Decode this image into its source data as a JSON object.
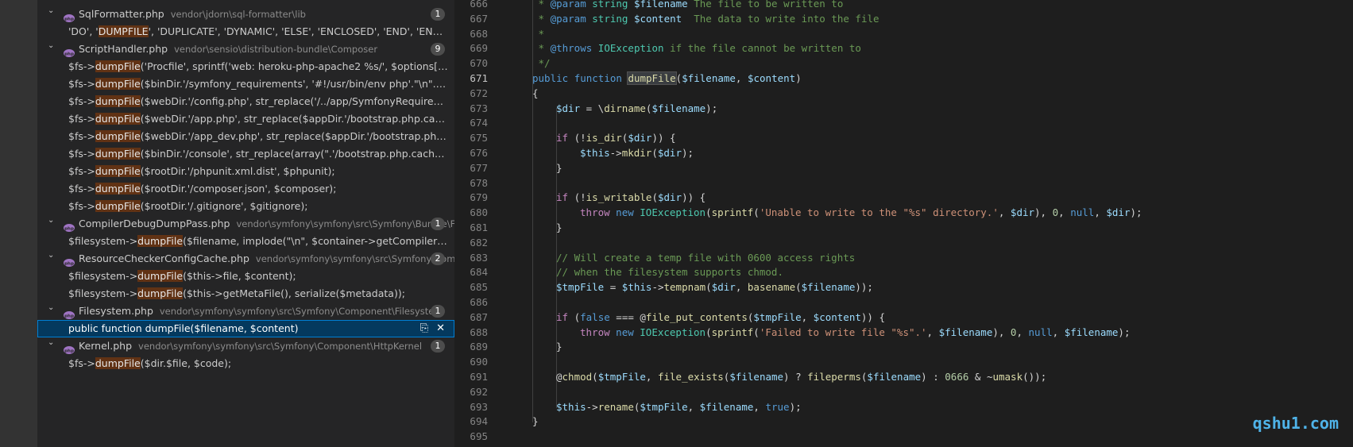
{
  "search_results": [
    {
      "type": "file",
      "name": "SqlFormatter.php",
      "path": "vendor\\jdorn\\sql-formatter\\lib",
      "count": "1"
    },
    {
      "type": "match",
      "pre": "'DO', '",
      "hl": "DUMPFILE",
      "post": "', 'DUPLICATE', 'DYNAMIC', 'ELSE', 'ENCLOSED', 'END', 'ENGINE', 'E..."
    },
    {
      "type": "file",
      "name": "ScriptHandler.php",
      "path": "vendor\\sensio\\distribution-bundle\\Composer",
      "count": "9"
    },
    {
      "type": "match",
      "pre": "$fs->",
      "hl": "dumpFile",
      "post": "('Procfile', sprintf('web: heroku-php-apache2 %s/', $options['symfon..."
    },
    {
      "type": "match",
      "pre": "$fs->",
      "hl": "dumpFile",
      "post": "($binDir.'/symfony_requirements', '#!/usr/bin/env php'.\"\\n\".str_repla..."
    },
    {
      "type": "match",
      "pre": "$fs->",
      "hl": "dumpFile",
      "post": "($webDir.'/config.php', str_replace('/../app/SymfonyRequirements.ph..."
    },
    {
      "type": "match",
      "pre": "$fs->",
      "hl": "dumpFile",
      "post": "($webDir.'/app.php', str_replace($appDir.'/bootstrap.php.cache', $var..."
    },
    {
      "type": "match",
      "pre": "$fs->",
      "hl": "dumpFile",
      "post": "($webDir.'/app_dev.php', str_replace($appDir.'/bootstrap.php.cache',..."
    },
    {
      "type": "match",
      "pre": "$fs->",
      "hl": "dumpFile",
      "post": "($binDir.'/console', str_replace(array(\".'/bootstrap.php.cache'\", \".'/Ap..."
    },
    {
      "type": "match",
      "pre": "$fs->",
      "hl": "dumpFile",
      "post": "($rootDir.'/phpunit.xml.dist', $phpunit);"
    },
    {
      "type": "match",
      "pre": "$fs->",
      "hl": "dumpFile",
      "post": "($rootDir.'/composer.json', $composer);"
    },
    {
      "type": "match",
      "pre": "$fs->",
      "hl": "dumpFile",
      "post": "($rootDir.'/.gitignore', $gitignore);"
    },
    {
      "type": "file",
      "name": "CompilerDebugDumpPass.php",
      "path": "vendor\\symfony\\symfony\\src\\Symfony\\Bundle\\F...",
      "count": "1"
    },
    {
      "type": "match",
      "pre": "$filesystem->",
      "hl": "dumpFile",
      "post": "($filename, implode(\"\\n\", $container->getCompiler()->getL..."
    },
    {
      "type": "file",
      "name": "ResourceCheckerConfigCache.php",
      "path": "vendor\\symfony\\symfony\\src\\Symfony\\Com...",
      "count": "2"
    },
    {
      "type": "match",
      "pre": "$filesystem->",
      "hl": "dumpFile",
      "post": "($this->file, $content);"
    },
    {
      "type": "match",
      "pre": "$filesystem->",
      "hl": "dumpFile",
      "post": "($this->getMetaFile(), serialize($metadata));"
    },
    {
      "type": "file",
      "name": "Filesystem.php",
      "path": "vendor\\symfony\\symfony\\src\\Symfony\\Component\\Filesystem",
      "count": "1"
    },
    {
      "type": "match",
      "pre": "public function ",
      "hl": "dumpFile",
      "post": "($filename, $content)",
      "selected": true
    },
    {
      "type": "file",
      "name": "Kernel.php",
      "path": "vendor\\symfony\\symfony\\src\\Symfony\\Component\\HttpKernel",
      "count": "1"
    },
    {
      "type": "match",
      "pre": "$fs->",
      "hl": "dumpFile",
      "post": "($dir.$file, $code);"
    }
  ],
  "selected_icons": {
    "replace": "⎘",
    "dismiss": "✕"
  },
  "editor": {
    "active_line": "671",
    "lines": [
      {
        "n": "666",
        "indent": 0,
        "toks": [
          {
            "c": "com",
            "t": " * "
          },
          {
            "c": "doc",
            "t": "@param"
          },
          {
            "c": "com",
            "t": " "
          },
          {
            "c": "cls",
            "t": "string"
          },
          {
            "c": "com",
            "t": " "
          },
          {
            "c": "var",
            "t": "$filename"
          },
          {
            "c": "com",
            "t": " The file to be written to"
          }
        ]
      },
      {
        "n": "667",
        "indent": 0,
        "toks": [
          {
            "c": "com",
            "t": " * "
          },
          {
            "c": "doc",
            "t": "@param"
          },
          {
            "c": "com",
            "t": " "
          },
          {
            "c": "cls",
            "t": "string"
          },
          {
            "c": "com",
            "t": " "
          },
          {
            "c": "var",
            "t": "$content"
          },
          {
            "c": "com",
            "t": "  The data to write into the file"
          }
        ]
      },
      {
        "n": "668",
        "indent": 0,
        "toks": [
          {
            "c": "com",
            "t": " *"
          }
        ]
      },
      {
        "n": "669",
        "indent": 0,
        "toks": [
          {
            "c": "com",
            "t": " * "
          },
          {
            "c": "doc",
            "t": "@throws"
          },
          {
            "c": "com",
            "t": " "
          },
          {
            "c": "cls",
            "t": "IOException"
          },
          {
            "c": "com",
            "t": " if the file cannot be written to"
          }
        ]
      },
      {
        "n": "670",
        "indent": 0,
        "toks": [
          {
            "c": "com",
            "t": " */"
          }
        ]
      },
      {
        "n": "671",
        "indent": 0,
        "toks": [
          {
            "c": "kw",
            "t": "public"
          },
          {
            "c": "plain",
            "t": " "
          },
          {
            "c": "kw",
            "t": "function"
          },
          {
            "c": "plain",
            "t": " "
          },
          {
            "c": "fnbox",
            "t": "dumpFile"
          },
          {
            "c": "plain",
            "t": "("
          },
          {
            "c": "var",
            "t": "$filename"
          },
          {
            "c": "plain",
            "t": ", "
          },
          {
            "c": "var",
            "t": "$content"
          },
          {
            "c": "plain",
            "t": ")"
          }
        ]
      },
      {
        "n": "672",
        "indent": 0,
        "toks": [
          {
            "c": "plain",
            "t": "{"
          }
        ]
      },
      {
        "n": "673",
        "indent": 1,
        "toks": [
          {
            "c": "var",
            "t": "$dir"
          },
          {
            "c": "plain",
            "t": " = \\"
          },
          {
            "c": "fn",
            "t": "dirname"
          },
          {
            "c": "plain",
            "t": "("
          },
          {
            "c": "var",
            "t": "$filename"
          },
          {
            "c": "plain",
            "t": ");"
          }
        ]
      },
      {
        "n": "674",
        "indent": 1,
        "toks": []
      },
      {
        "n": "675",
        "indent": 1,
        "toks": [
          {
            "c": "ctl",
            "t": "if"
          },
          {
            "c": "plain",
            "t": " (!"
          },
          {
            "c": "fn",
            "t": "is_dir"
          },
          {
            "c": "plain",
            "t": "("
          },
          {
            "c": "var",
            "t": "$dir"
          },
          {
            "c": "plain",
            "t": ")) {"
          }
        ]
      },
      {
        "n": "676",
        "indent": 2,
        "toks": [
          {
            "c": "var",
            "t": "$this"
          },
          {
            "c": "plain",
            "t": "->"
          },
          {
            "c": "fn",
            "t": "mkdir"
          },
          {
            "c": "plain",
            "t": "("
          },
          {
            "c": "var",
            "t": "$dir"
          },
          {
            "c": "plain",
            "t": ");"
          }
        ]
      },
      {
        "n": "677",
        "indent": 1,
        "toks": [
          {
            "c": "plain",
            "t": "}"
          }
        ]
      },
      {
        "n": "678",
        "indent": 1,
        "toks": []
      },
      {
        "n": "679",
        "indent": 1,
        "toks": [
          {
            "c": "ctl",
            "t": "if"
          },
          {
            "c": "plain",
            "t": " (!"
          },
          {
            "c": "fn",
            "t": "is_writable"
          },
          {
            "c": "plain",
            "t": "("
          },
          {
            "c": "var",
            "t": "$dir"
          },
          {
            "c": "plain",
            "t": ")) {"
          }
        ]
      },
      {
        "n": "680",
        "indent": 2,
        "toks": [
          {
            "c": "ctl",
            "t": "throw"
          },
          {
            "c": "plain",
            "t": " "
          },
          {
            "c": "kw",
            "t": "new"
          },
          {
            "c": "plain",
            "t": " "
          },
          {
            "c": "cls",
            "t": "IOException"
          },
          {
            "c": "plain",
            "t": "("
          },
          {
            "c": "fn",
            "t": "sprintf"
          },
          {
            "c": "plain",
            "t": "("
          },
          {
            "c": "str",
            "t": "'Unable to write to the \"%s\" directory.'"
          },
          {
            "c": "plain",
            "t": ", "
          },
          {
            "c": "var",
            "t": "$dir"
          },
          {
            "c": "plain",
            "t": "), "
          },
          {
            "c": "num",
            "t": "0"
          },
          {
            "c": "plain",
            "t": ", "
          },
          {
            "c": "kw",
            "t": "null"
          },
          {
            "c": "plain",
            "t": ", "
          },
          {
            "c": "var",
            "t": "$dir"
          },
          {
            "c": "plain",
            "t": ");"
          }
        ]
      },
      {
        "n": "681",
        "indent": 1,
        "toks": [
          {
            "c": "plain",
            "t": "}"
          }
        ]
      },
      {
        "n": "682",
        "indent": 1,
        "toks": []
      },
      {
        "n": "683",
        "indent": 1,
        "toks": [
          {
            "c": "com",
            "t": "// Will create a temp file with 0600 access rights"
          }
        ]
      },
      {
        "n": "684",
        "indent": 1,
        "toks": [
          {
            "c": "com",
            "t": "// when the filesystem supports chmod."
          }
        ]
      },
      {
        "n": "685",
        "indent": 1,
        "toks": [
          {
            "c": "var",
            "t": "$tmpFile"
          },
          {
            "c": "plain",
            "t": " = "
          },
          {
            "c": "var",
            "t": "$this"
          },
          {
            "c": "plain",
            "t": "->"
          },
          {
            "c": "fn",
            "t": "tempnam"
          },
          {
            "c": "plain",
            "t": "("
          },
          {
            "c": "var",
            "t": "$dir"
          },
          {
            "c": "plain",
            "t": ", "
          },
          {
            "c": "fn",
            "t": "basename"
          },
          {
            "c": "plain",
            "t": "("
          },
          {
            "c": "var",
            "t": "$filename"
          },
          {
            "c": "plain",
            "t": "));"
          }
        ]
      },
      {
        "n": "686",
        "indent": 1,
        "toks": []
      },
      {
        "n": "687",
        "indent": 1,
        "toks": [
          {
            "c": "ctl",
            "t": "if"
          },
          {
            "c": "plain",
            "t": " ("
          },
          {
            "c": "kw",
            "t": "false"
          },
          {
            "c": "plain",
            "t": " === @"
          },
          {
            "c": "fn",
            "t": "file_put_contents"
          },
          {
            "c": "plain",
            "t": "("
          },
          {
            "c": "var",
            "t": "$tmpFile"
          },
          {
            "c": "plain",
            "t": ", "
          },
          {
            "c": "var",
            "t": "$content"
          },
          {
            "c": "plain",
            "t": ")) {"
          }
        ]
      },
      {
        "n": "688",
        "indent": 2,
        "toks": [
          {
            "c": "ctl",
            "t": "throw"
          },
          {
            "c": "plain",
            "t": " "
          },
          {
            "c": "kw",
            "t": "new"
          },
          {
            "c": "plain",
            "t": " "
          },
          {
            "c": "cls",
            "t": "IOException"
          },
          {
            "c": "plain",
            "t": "("
          },
          {
            "c": "fn",
            "t": "sprintf"
          },
          {
            "c": "plain",
            "t": "("
          },
          {
            "c": "str",
            "t": "'Failed to write file \"%s\".'"
          },
          {
            "c": "plain",
            "t": ", "
          },
          {
            "c": "var",
            "t": "$filename"
          },
          {
            "c": "plain",
            "t": "), "
          },
          {
            "c": "num",
            "t": "0"
          },
          {
            "c": "plain",
            "t": ", "
          },
          {
            "c": "kw",
            "t": "null"
          },
          {
            "c": "plain",
            "t": ", "
          },
          {
            "c": "var",
            "t": "$filename"
          },
          {
            "c": "plain",
            "t": ");"
          }
        ]
      },
      {
        "n": "689",
        "indent": 1,
        "toks": [
          {
            "c": "plain",
            "t": "}"
          }
        ]
      },
      {
        "n": "690",
        "indent": 1,
        "toks": []
      },
      {
        "n": "691",
        "indent": 1,
        "toks": [
          {
            "c": "plain",
            "t": "@"
          },
          {
            "c": "fn",
            "t": "chmod"
          },
          {
            "c": "plain",
            "t": "("
          },
          {
            "c": "var",
            "t": "$tmpFile"
          },
          {
            "c": "plain",
            "t": ", "
          },
          {
            "c": "fn",
            "t": "file_exists"
          },
          {
            "c": "plain",
            "t": "("
          },
          {
            "c": "var",
            "t": "$filename"
          },
          {
            "c": "plain",
            "t": ") ? "
          },
          {
            "c": "fn",
            "t": "fileperms"
          },
          {
            "c": "plain",
            "t": "("
          },
          {
            "c": "var",
            "t": "$filename"
          },
          {
            "c": "plain",
            "t": ") : "
          },
          {
            "c": "num",
            "t": "0666"
          },
          {
            "c": "plain",
            "t": " & ~"
          },
          {
            "c": "fn",
            "t": "umask"
          },
          {
            "c": "plain",
            "t": "());"
          }
        ]
      },
      {
        "n": "692",
        "indent": 1,
        "toks": []
      },
      {
        "n": "693",
        "indent": 1,
        "toks": [
          {
            "c": "var",
            "t": "$this"
          },
          {
            "c": "plain",
            "t": "->"
          },
          {
            "c": "fn",
            "t": "rename"
          },
          {
            "c": "plain",
            "t": "("
          },
          {
            "c": "var",
            "t": "$tmpFile"
          },
          {
            "c": "plain",
            "t": ", "
          },
          {
            "c": "var",
            "t": "$filename"
          },
          {
            "c": "plain",
            "t": ", "
          },
          {
            "c": "kw",
            "t": "true"
          },
          {
            "c": "plain",
            "t": ");"
          }
        ]
      },
      {
        "n": "694",
        "indent": 0,
        "toks": [
          {
            "c": "plain",
            "t": "}"
          }
        ]
      },
      {
        "n": "695",
        "indent": 0,
        "toks": []
      }
    ]
  },
  "watermark": "qshu1.com"
}
